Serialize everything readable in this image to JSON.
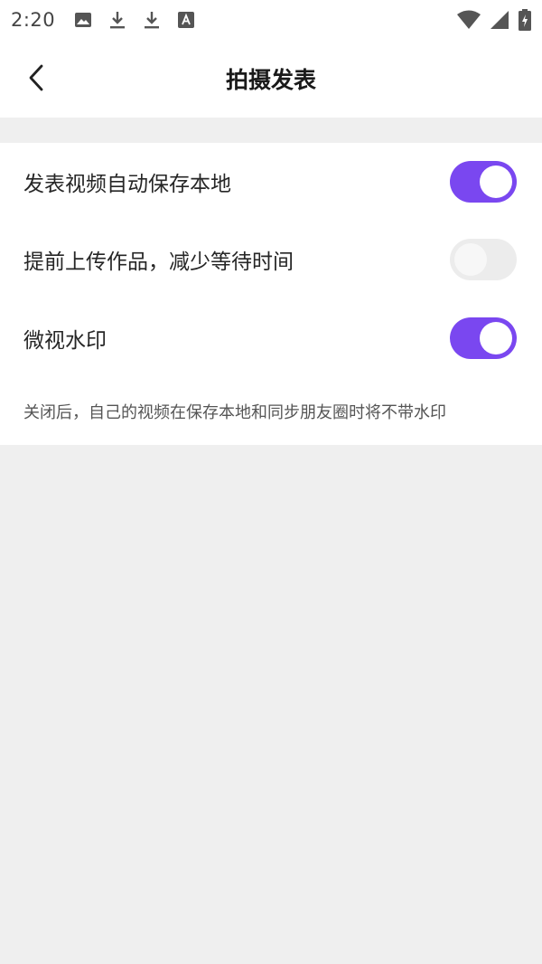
{
  "status_bar": {
    "time": "2:20",
    "icons_left": [
      "image-icon",
      "download-icon",
      "download-icon",
      "font-icon"
    ],
    "icons_right": [
      "wifi-icon",
      "signal-icon",
      "battery-icon"
    ]
  },
  "header": {
    "title": "拍摄发表",
    "back_icon": "chevron-left-icon"
  },
  "settings": [
    {
      "label": "发表视频自动保存本地",
      "enabled": true
    },
    {
      "label": "提前上传作品，减少等待时间",
      "enabled": false
    },
    {
      "label": "微视水印",
      "enabled": true
    }
  ],
  "note": "关闭后，自己的视频在保存本地和同步朋友圈时将不带水印",
  "colors": {
    "accent": "#7a47f0",
    "toggle_off": "#ececec",
    "background": "#efefef"
  }
}
